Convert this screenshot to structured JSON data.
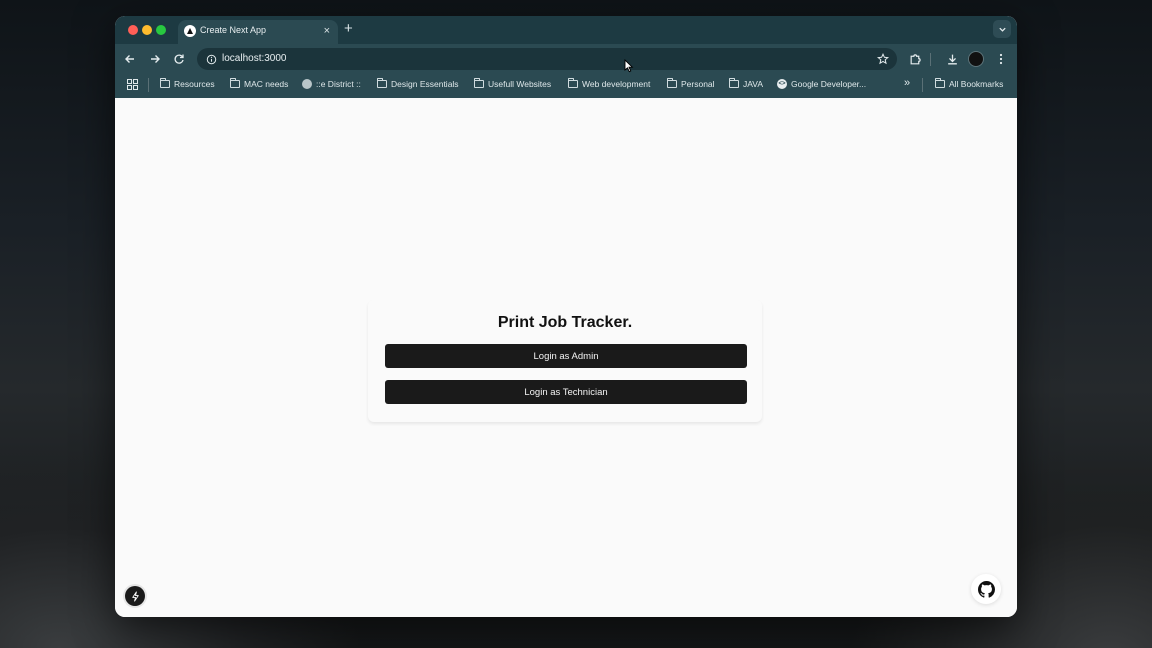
{
  "browser": {
    "tab_title": "Create Next App",
    "tab_close": "×",
    "new_tab": "+",
    "url": "localhost:3000"
  },
  "bookmarks": {
    "items": [
      {
        "label": "Resources",
        "icon": "folder-icon"
      },
      {
        "label": "MAC needs",
        "icon": "folder-icon"
      },
      {
        "label": "::e District ::",
        "icon": "globe-icon"
      },
      {
        "label": "Design Essentials",
        "icon": "folder-icon"
      },
      {
        "label": "Usefull Websites",
        "icon": "folder-icon"
      },
      {
        "label": "Web development",
        "icon": "folder-icon"
      },
      {
        "label": "Personal",
        "icon": "folder-icon"
      },
      {
        "label": "JAVA",
        "icon": "folder-icon"
      },
      {
        "label": "Google Developer...",
        "icon": "google-developers-icon"
      }
    ],
    "overflow": "»",
    "all_bookmarks": "All Bookmarks"
  },
  "page": {
    "title": "Print Job Tracker.",
    "admin_button": "Login as Admin",
    "technician_button": "Login as Technician"
  },
  "colors": {
    "browser_chrome": "#2b4a52",
    "button_bg": "#1a1a1a",
    "page_bg": "#fafafa"
  }
}
